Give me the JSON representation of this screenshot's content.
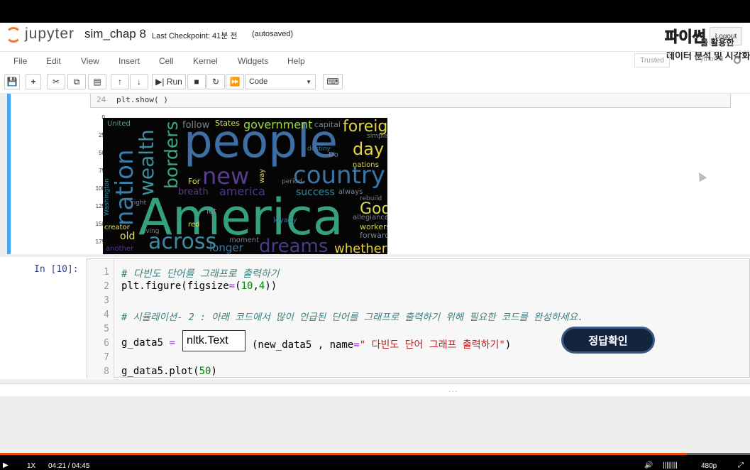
{
  "header": {
    "logo_text": "jupyter",
    "notebook_name": "sim_chap 8",
    "checkpoint": "Last Checkpoint: 41분 전",
    "autosaved": "(autosaved)",
    "logout": "Logout",
    "brand_title": "파이썬",
    "brand_line1": "을 활용한",
    "brand_line2": "데이터 분석 및 시각화"
  },
  "menu": [
    "File",
    "Edit",
    "View",
    "Insert",
    "Cell",
    "Kernel",
    "Widgets",
    "Help"
  ],
  "status": {
    "trusted": "Trusted",
    "kernel": "Python 3"
  },
  "toolbar": {
    "run_label": "Run",
    "cell_type": "Code"
  },
  "prev_cell": {
    "line_number": "24",
    "code": "plt.show( )"
  },
  "wordcloud": {
    "y_ticks": [
      "0",
      "25",
      "50",
      "75",
      "100",
      "125",
      "150",
      "175"
    ],
    "words": [
      "America",
      "people",
      "nation",
      "wealth",
      "borders",
      "country",
      "new",
      "across",
      "dreams",
      "foreign",
      "day",
      "government",
      "whether",
      "God",
      "america",
      "success",
      "longer",
      "old",
      "creator",
      "workers",
      "follow",
      "States",
      "United",
      "capital",
      "nations",
      "For",
      "always",
      "loyalty",
      "moment",
      "another",
      "rebuild",
      "forward",
      "allegiance",
      "breath",
      "Washington",
      "red",
      "Do",
      "simple",
      "destiny",
      "giving",
      "period",
      "let",
      "way",
      "right"
    ]
  },
  "cell": {
    "prompt": "In [10]:",
    "line_numbers": [
      "1",
      "2",
      "3",
      "4",
      "5",
      "6",
      "7",
      "8"
    ],
    "line1": "# 다빈도 단어를 그래프로 출력하기",
    "line2_a": "plt.figure(figsize",
    "line2_b": "=",
    "line2_c": "(",
    "line2_d": "10",
    "line2_e": ",",
    "line2_f": "4",
    "line2_g": "))",
    "line4": "# 시뮬레이션- 2 : 아래 코드에서 많이 언급된 단어를 그래프로 출력하기 위해  필요한 코드를 완성하세요.",
    "line6_a": "g_data5",
    "line6_b": "=",
    "line6_c": "(new_data5 , name",
    "line6_d": "=",
    "line6_e": "\" 다빈도 단어 그래프 출력하기\"",
    "line6_f": ")",
    "line8_a": "g_data5.plot(",
    "line8_b": "50",
    "line8_c": ")",
    "answer_value": "nltk.Text",
    "check_button": "정답확인"
  },
  "player": {
    "speed": "1X",
    "time": "04:21 / 04:45",
    "quality": "480p",
    "progress": 0.916
  }
}
